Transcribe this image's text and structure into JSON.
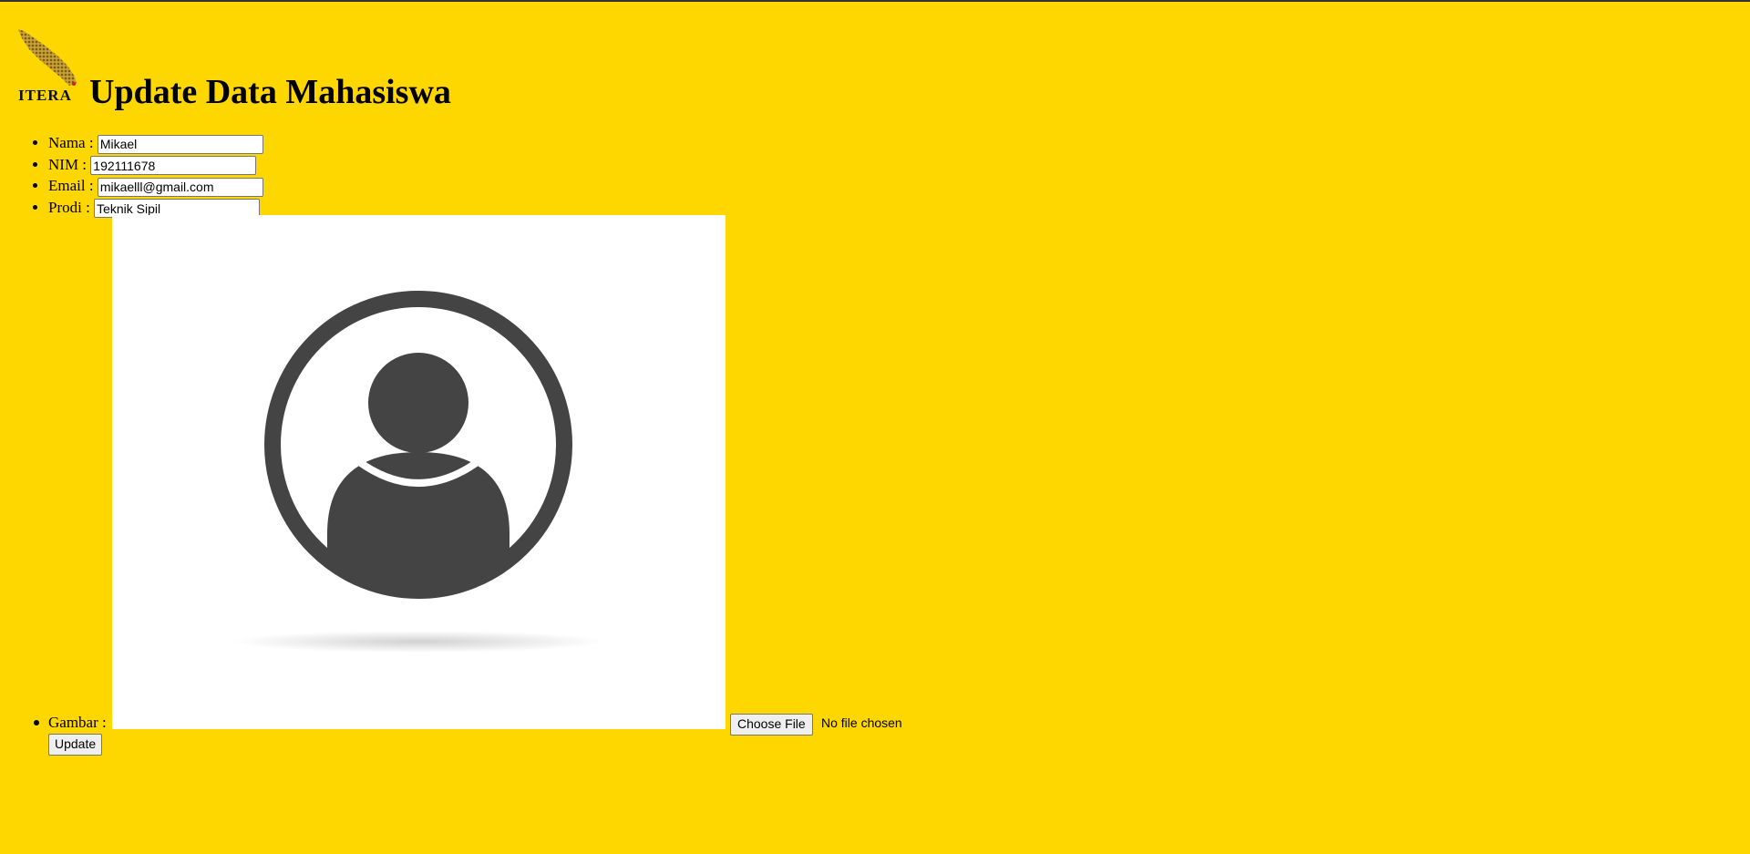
{
  "header": {
    "logo_text": "ITERA",
    "title": "Update Data Mahasiswa"
  },
  "form": {
    "nama": {
      "label": "Nama :",
      "value": "Mikael"
    },
    "nim": {
      "label": "NIM :",
      "value": "192111678"
    },
    "email": {
      "label": "Email :",
      "value": "mikaelll@gmail.com"
    },
    "prodi": {
      "label": "Prodi :",
      "value": "Teknik Sipil"
    },
    "gambar": {
      "label": "Gambar :",
      "choose_file_label": "Choose File",
      "file_status": "No file chosen"
    },
    "submit_label": "Update"
  },
  "colors": {
    "background": "#FFD700",
    "avatar_icon": "#444444"
  },
  "icons": {
    "photo": "user-avatar-icon",
    "logo": "itera-logo"
  }
}
